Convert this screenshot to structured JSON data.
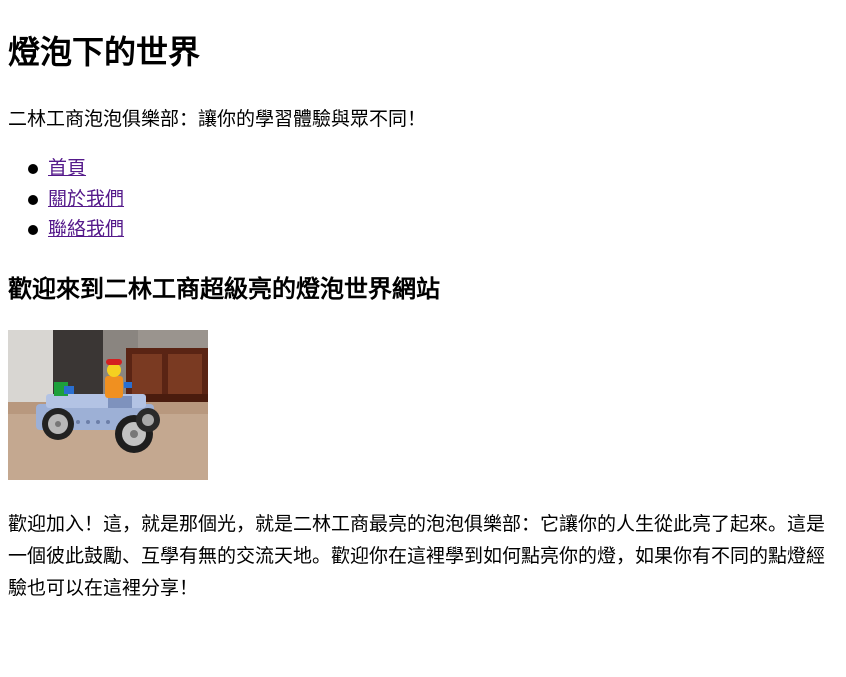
{
  "header": {
    "title": "燈泡下的世界",
    "tagline": "二林工商泡泡俱樂部：讓你的學習體驗與眾不同！"
  },
  "nav": {
    "items": [
      {
        "label": "首頁"
      },
      {
        "label": "關於我們"
      },
      {
        "label": "聯絡我們"
      }
    ],
    "link_color": "#551a8b"
  },
  "main": {
    "heading": "歡迎來到二林工商超級亮的燈泡世界網站",
    "image_subject": "lego-car-photo",
    "intro": "歡迎加入！這，就是那個光，就是二林工商最亮的泡泡俱樂部：它讓你的人生從此亮了起來。這是一個彼此鼓勵、互學有無的交流天地。歡迎你在這裡學到如何點亮你的燈，如果你有不同的點燈經驗也可以在這裡分享！"
  }
}
